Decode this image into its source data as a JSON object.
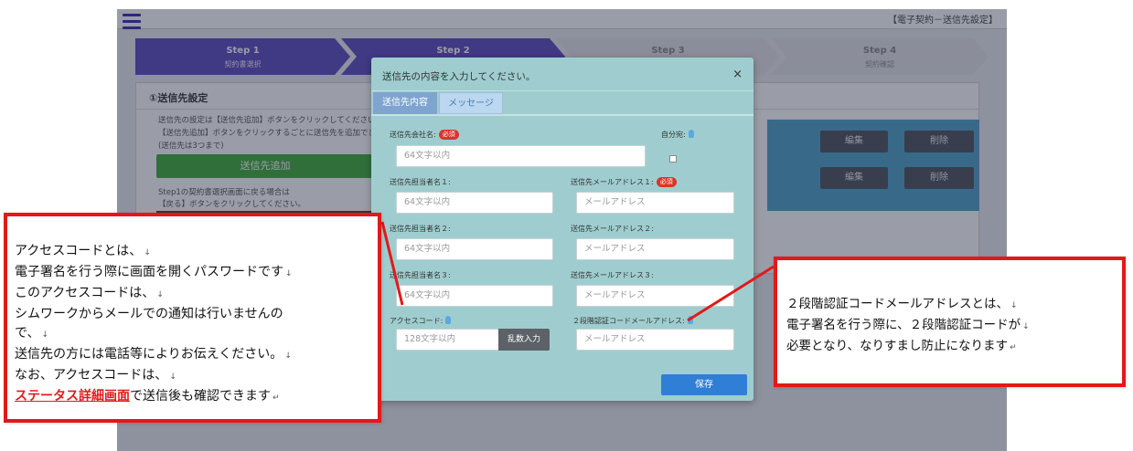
{
  "app": {
    "header_title": "【電子契約－送信先設定】",
    "steps": [
      {
        "title": "Step 1",
        "label": "契約書選択"
      },
      {
        "title": "Step 2",
        "label": ""
      },
      {
        "title": "Step 3",
        "label": ""
      },
      {
        "title": "Step 4",
        "label": "契約確認"
      }
    ],
    "panel": {
      "title": "①送信先設定",
      "text_lines": [
        "送信先の設定は【送信先追加】ボタンをクリックしてください。",
        "【送信先追加】ボタンをクリックするごとに送信先を追加できます",
        "(送信先は3つまで)"
      ],
      "add_button": "送信先追加",
      "back_lines": [
        "Step1の契約書選択画面に戻る場合は",
        "【戻る】ボタンをクリックしてください。"
      ],
      "edit_button": "編集",
      "delete_button": "削除"
    }
  },
  "modal": {
    "title": "送信先の内容を入力してください。",
    "close": "×",
    "tabs": [
      "送信先内容",
      "メッセージ"
    ],
    "required_badge": "必須",
    "fields": {
      "company_label": "送信先会社名:",
      "company_placeholder": "64文字以内",
      "self_label": "自分宛:",
      "person1_label": "送信先担当者名１:",
      "person1_placeholder": "64文字以内",
      "email1_label": "送信先メールアドレス１:",
      "email1_placeholder": "メールアドレス",
      "person2_label": "送信先担当者名２:",
      "person2_placeholder": "64文字以内",
      "email2_label": "送信先メールアドレス２:",
      "email2_placeholder": "メールアドレス",
      "person3_label": "送信先担当者名３:",
      "person3_placeholder": "64文字以内",
      "email3_label": "送信先メールアドレス３:",
      "email3_placeholder": "メールアドレス",
      "access_label": "アクセスコード:",
      "access_placeholder": "128文字以内",
      "random_button": "乱数入力",
      "twofa_label": "２段階認証コードメールアドレス:",
      "twofa_placeholder": "メールアドレス"
    },
    "save_button": "保存"
  },
  "callout_left": {
    "lines": [
      "アクセスコードとは、",
      "電子署名を行う際に画面を開くパスワードです",
      "このアクセスコードは、",
      "シムワークからメールでの通知は行いませんの",
      "で、",
      "送信先の方には電話等によりお伝えください。",
      "なお、アクセスコードは、"
    ],
    "emphasis": "ステータス詳細画面",
    "last_suffix": "で送信後も確認できます",
    "line_marker": "↓",
    "end_marker": "↵"
  },
  "callout_right": {
    "lines": [
      "２段階認証コードメールアドレスとは、",
      "電子署名を行う際に、２段階認証コードが",
      "必要となり、なりすまし防止になります"
    ],
    "line_marker": "↓",
    "end_marker": "↵"
  },
  "colors": {
    "accent_purple": "#5b4cc0",
    "modal_bg": "#9fcdcf",
    "callout_border": "#e21919",
    "save_blue": "#2f7fd6",
    "add_green": "#3fae3a"
  }
}
